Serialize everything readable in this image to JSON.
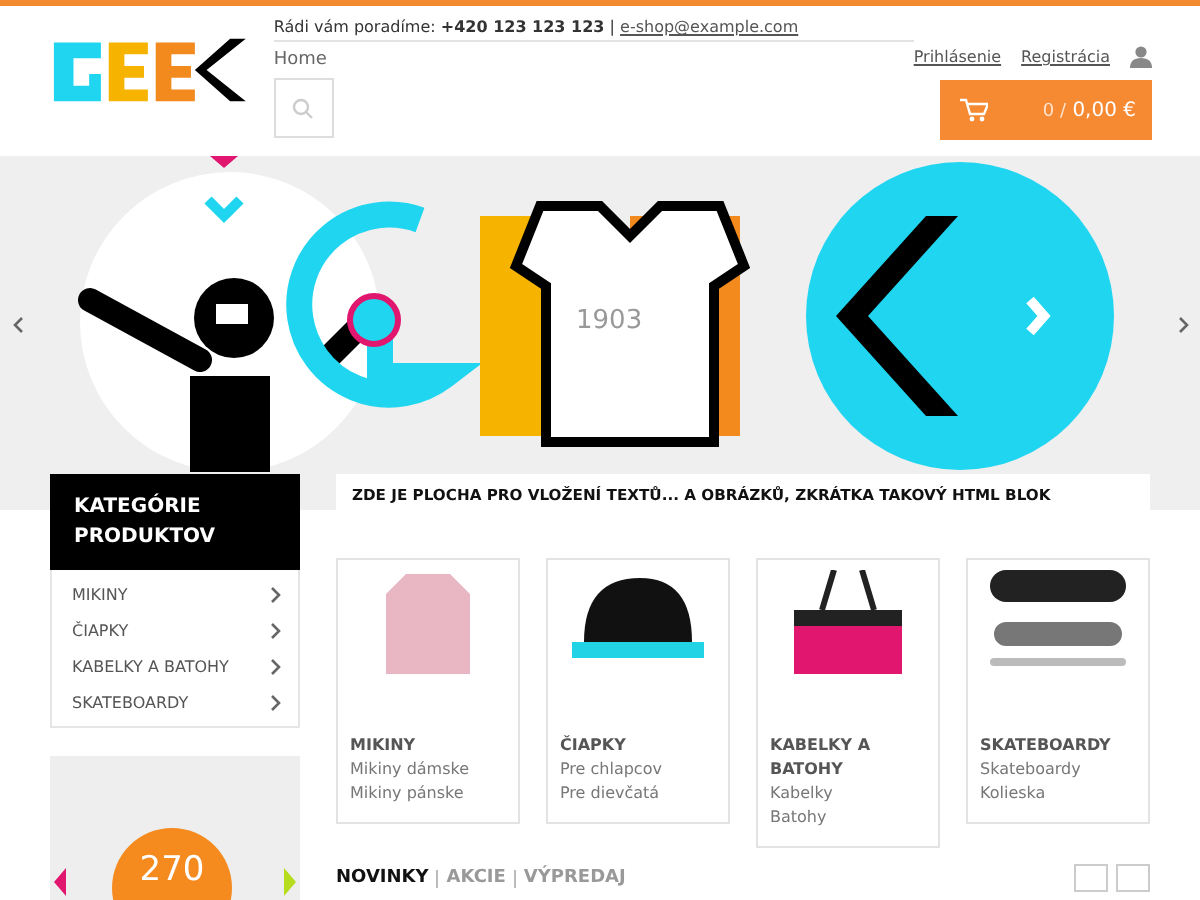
{
  "header": {
    "contact_label": "Rádi vám poradíme:",
    "phone": "+420 123 123 123",
    "separator": "|",
    "email": "e-shop@example.com",
    "breadcrumb": "Home",
    "login": "Prihlásenie",
    "register": "Registrácia",
    "cart": {
      "count": "0",
      "divider": "/",
      "total": "0,00 €"
    }
  },
  "banner": {
    "shirt_number": "1903"
  },
  "categories": {
    "title": "KATEGÓRIE PRODUKTOV",
    "items": [
      {
        "label": "MIKINY"
      },
      {
        "label": "ČIAPKY"
      },
      {
        "label": "KABELKY A BATOHY"
      },
      {
        "label": "SKATEBOARDY"
      }
    ]
  },
  "promo": {
    "number": "270"
  },
  "html_block": "ZDE JE PLOCHA PRO VLOŽENÍ TEXTŮ... A OBRÁZKŮ, ZKRÁTKA TAKOVÝ HTML BLOK",
  "cards": [
    {
      "kind": "hoodie",
      "title": "MIKINY",
      "links": [
        "Mikiny dámske",
        "Mikiny pánske"
      ]
    },
    {
      "kind": "cap",
      "title": "ČIAPKY",
      "links": [
        "Pre chlapcov",
        "Pre dievčatá"
      ]
    },
    {
      "kind": "bag",
      "title": "KABELKY A BATOHY",
      "links": [
        "Kabelky",
        "Batohy"
      ]
    },
    {
      "kind": "skateboard",
      "title": "SKATEBOARDY",
      "links": [
        "Skateboardy",
        "Kolieska"
      ]
    }
  ],
  "product_tabs": [
    {
      "label": "NOVINKY",
      "selected": true
    },
    {
      "label": "AKCIE",
      "selected": false
    },
    {
      "label": "VÝPREDAJ",
      "selected": false
    }
  ]
}
